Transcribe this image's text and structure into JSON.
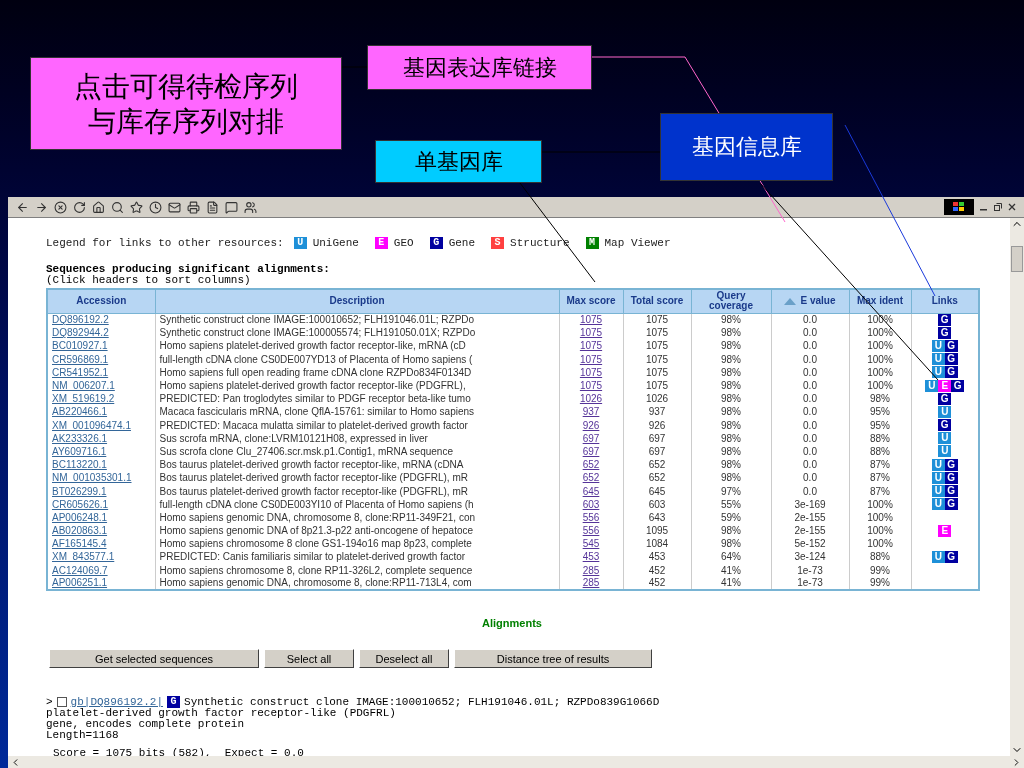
{
  "callouts": [
    {
      "kind": "magenta",
      "lines": [
        "点击可得待检序列",
        "与库存序列对排"
      ]
    },
    {
      "kind": "pink",
      "lines": [
        "基因表达库链接"
      ]
    },
    {
      "kind": "cyan",
      "lines": [
        "单基因库"
      ]
    },
    {
      "kind": "blue",
      "lines": [
        "基因信息库"
      ]
    }
  ],
  "legend": {
    "label": "Legend for links to other resources:",
    "items": [
      {
        "letter": "U",
        "name": "UniGene",
        "kind": "unigene"
      },
      {
        "letter": "E",
        "name": "GEO",
        "kind": "geo"
      },
      {
        "letter": "G",
        "name": "Gene",
        "kind": "gene"
      },
      {
        "letter": "S",
        "name": "Structure",
        "kind": "structure"
      },
      {
        "letter": "M",
        "name": "Map Viewer",
        "kind": "map"
      }
    ]
  },
  "heading": "Sequences producing significant alignments:",
  "subheading": "(Click headers to sort columns)",
  "table": {
    "columns": [
      {
        "label": "Accession",
        "sorted": false
      },
      {
        "label": "Description",
        "sorted": false
      },
      {
        "label": "Max score",
        "sorted": false
      },
      {
        "label": "Total score",
        "sorted": false
      },
      {
        "label": "Query coverage",
        "sorted": false
      },
      {
        "label": "E value",
        "sorted": true
      },
      {
        "label": "Max ident",
        "sorted": false
      },
      {
        "label": "Links",
        "sorted": false
      }
    ],
    "rows": [
      {
        "accession": "DQ896192.2",
        "description": "Synthetic construct clone IMAGE:100010652; FLH191046.01L; RZPDo",
        "max_score": "1075",
        "total_score": "1075",
        "coverage": "98%",
        "e_value": "0.0",
        "ident": "100%",
        "links": [
          {
            "letter": "G",
            "kind": "gene"
          }
        ]
      },
      {
        "accession": "DQ892944.2",
        "description": "Synthetic construct clone IMAGE:100005574; FLH191050.01X; RZPDo",
        "max_score": "1075",
        "total_score": "1075",
        "coverage": "98%",
        "e_value": "0.0",
        "ident": "100%",
        "links": [
          {
            "letter": "G",
            "kind": "gene"
          }
        ]
      },
      {
        "accession": "BC010927.1",
        "description": "Homo sapiens platelet-derived growth factor receptor-like, mRNA (cD",
        "max_score": "1075",
        "total_score": "1075",
        "coverage": "98%",
        "e_value": "0.0",
        "ident": "100%",
        "links": [
          {
            "letter": "U",
            "kind": "unigene"
          },
          {
            "letter": "G",
            "kind": "gene"
          }
        ]
      },
      {
        "accession": "CR596869.1",
        "description": "full-length cDNA clone CS0DE007YD13 of Placenta of Homo sapiens (",
        "max_score": "1075",
        "total_score": "1075",
        "coverage": "98%",
        "e_value": "0.0",
        "ident": "100%",
        "links": [
          {
            "letter": "U",
            "kind": "unigene"
          },
          {
            "letter": "G",
            "kind": "gene"
          }
        ]
      },
      {
        "accession": "CR541952.1",
        "description": "Homo sapiens full open reading frame cDNA clone RZPDo834F0134D",
        "max_score": "1075",
        "total_score": "1075",
        "coverage": "98%",
        "e_value": "0.0",
        "ident": "100%",
        "links": [
          {
            "letter": "U",
            "kind": "unigene"
          },
          {
            "letter": "G",
            "kind": "gene"
          }
        ]
      },
      {
        "accession": "NM_006207.1",
        "description": "Homo sapiens platelet-derived growth factor receptor-like (PDGFRL),",
        "max_score": "1075",
        "total_score": "1075",
        "coverage": "98%",
        "e_value": "0.0",
        "ident": "100%",
        "links": [
          {
            "letter": "U",
            "kind": "unigene"
          },
          {
            "letter": "E",
            "kind": "geo"
          },
          {
            "letter": "G",
            "kind": "gene"
          }
        ]
      },
      {
        "accession": "XM_519619.2",
        "description": "PREDICTED: Pan troglodytes similar to PDGF receptor beta-like tumo",
        "max_score": "1026",
        "total_score": "1026",
        "coverage": "98%",
        "e_value": "0.0",
        "ident": "98%",
        "links": [
          {
            "letter": "G",
            "kind": "gene"
          }
        ]
      },
      {
        "accession": "AB220466.1",
        "description": "Macaca fascicularis mRNA, clone QflA-15761: similar to Homo sapiens",
        "max_score": "937",
        "total_score": "937",
        "coverage": "98%",
        "e_value": "0.0",
        "ident": "95%",
        "links": [
          {
            "letter": "U",
            "kind": "unigene"
          }
        ]
      },
      {
        "accession": "XM_001096474.1",
        "description": "PREDICTED: Macaca mulatta similar to platelet-derived growth factor",
        "max_score": "926",
        "total_score": "926",
        "coverage": "98%",
        "e_value": "0.0",
        "ident": "95%",
        "links": [
          {
            "letter": "G",
            "kind": "gene"
          }
        ]
      },
      {
        "accession": "AK233326.1",
        "description": "Sus scrofa mRNA, clone:LVRM10121H08, expressed in liver",
        "max_score": "697",
        "total_score": "697",
        "coverage": "98%",
        "e_value": "0.0",
        "ident": "88%",
        "links": [
          {
            "letter": "U",
            "kind": "unigene"
          }
        ]
      },
      {
        "accession": "AY609716.1",
        "description": "Sus scrofa clone Clu_27406.scr.msk.p1.Contig1, mRNA sequence",
        "max_score": "697",
        "total_score": "697",
        "coverage": "98%",
        "e_value": "0.0",
        "ident": "88%",
        "links": [
          {
            "letter": "U",
            "kind": "unigene"
          }
        ]
      },
      {
        "accession": "BC113220.1",
        "description": "Bos taurus platelet-derived growth factor receptor-like, mRNA (cDNA",
        "max_score": "652",
        "total_score": "652",
        "coverage": "98%",
        "e_value": "0.0",
        "ident": "87%",
        "links": [
          {
            "letter": "U",
            "kind": "unigene"
          },
          {
            "letter": "G",
            "kind": "gene"
          }
        ]
      },
      {
        "accession": "NM_001035301.1",
        "description": "Bos taurus platelet-derived growth factor receptor-like (PDGFRL), mR",
        "max_score": "652",
        "total_score": "652",
        "coverage": "98%",
        "e_value": "0.0",
        "ident": "87%",
        "links": [
          {
            "letter": "U",
            "kind": "unigene"
          },
          {
            "letter": "G",
            "kind": "gene"
          }
        ]
      },
      {
        "accession": "BT026299.1",
        "description": "Bos taurus platelet-derived growth factor receptor-like (PDGFRL), mR",
        "max_score": "645",
        "total_score": "645",
        "coverage": "97%",
        "e_value": "0.0",
        "ident": "87%",
        "links": [
          {
            "letter": "U",
            "kind": "unigene"
          },
          {
            "letter": "G",
            "kind": "gene"
          }
        ]
      },
      {
        "accession": "CR605626.1",
        "description": "full-length cDNA clone CS0DE003YI10 of Placenta of Homo sapiens (h",
        "max_score": "603",
        "total_score": "603",
        "coverage": "55%",
        "e_value": "3e-169",
        "ident": "100%",
        "links": [
          {
            "letter": "U",
            "kind": "unigene"
          },
          {
            "letter": "G",
            "kind": "gene"
          }
        ]
      },
      {
        "accession": "AP006248.1",
        "description": "Homo sapiens genomic DNA, chromosome 8, clone:RP11-349F21, con",
        "max_score": "556",
        "total_score": "643",
        "coverage": "59%",
        "e_value": "2e-155",
        "ident": "100%",
        "links": []
      },
      {
        "accession": "AB020863.1",
        "description": "Homo sapiens genomic DNA of 8p21.3-p22 anti-oncogene of hepatoce",
        "max_score": "556",
        "total_score": "1095",
        "coverage": "98%",
        "e_value": "2e-155",
        "ident": "100%",
        "links": [
          {
            "letter": "E",
            "kind": "geo"
          }
        ]
      },
      {
        "accession": "AF165145.4",
        "description": "Homo sapiens chromosome 8 clone GS1-194o16 map 8p23, complete",
        "max_score": "545",
        "total_score": "1084",
        "coverage": "98%",
        "e_value": "5e-152",
        "ident": "100%",
        "links": []
      },
      {
        "accession": "XM_843577.1",
        "description": "PREDICTED: Canis familiaris similar to platelet-derived growth factor",
        "max_score": "453",
        "total_score": "453",
        "coverage": "64%",
        "e_value": "3e-124",
        "ident": "88%",
        "links": [
          {
            "letter": "U",
            "kind": "unigene"
          },
          {
            "letter": "G",
            "kind": "gene"
          }
        ]
      },
      {
        "accession": "AC124069.7",
        "description": "Homo sapiens chromosome 8, clone RP11-326L2, complete sequence",
        "max_score": "285",
        "total_score": "452",
        "coverage": "41%",
        "e_value": "1e-73",
        "ident": "99%",
        "links": []
      },
      {
        "accession": "AP006251.1",
        "description": "Homo sapiens genomic DNA, chromosome 8, clone:RP11-713L4, com",
        "max_score": "285",
        "total_score": "452",
        "coverage": "41%",
        "e_value": "1e-73",
        "ident": "99%",
        "links": []
      }
    ]
  },
  "alignments_title": "Alignments",
  "buttons": [
    "Get selected sequences",
    "Select all",
    "Deselect all",
    "Distance tree of results"
  ],
  "alignment": {
    "prefix": ">",
    "checked": false,
    "link": "gb|DQ896192.2|",
    "badge": {
      "letter": "G",
      "kind": "gene"
    },
    "title": "Synthetic construct clone IMAGE:100010652; FLH191046.01L; RZPDo839G1066D",
    "lines": [
      "platelet-derived growth factor receptor-like (PDGFRL)",
      "gene, encodes complete protein",
      "Length=1168"
    ],
    "score": "Score = 1075 bits (582),  Expect = 0.0"
  }
}
